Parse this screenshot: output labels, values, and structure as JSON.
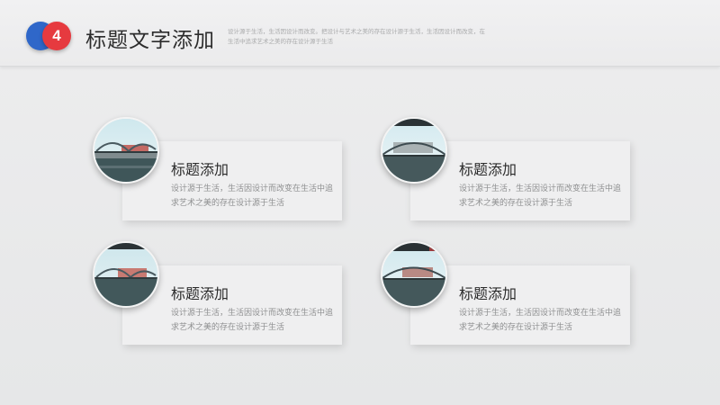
{
  "header": {
    "badge_number": "4",
    "title": "标题文字添加",
    "description": "设计源于生活，生活因设计而改变。把设计与艺术之美的存在设计源于生活，生活因设计而改变，在生活中追求艺术之美的存在设计源于生活"
  },
  "cards": [
    {
      "title": "标题添加",
      "body": "设计源于生活，生活因设计而改变在生活中追求艺术之美的存在设计源于生活",
      "image": "bridge-photo"
    },
    {
      "title": "标题添加",
      "body": "设计源于生活，生活因设计而改变在生活中追求艺术之美的存在设计源于生活",
      "image": "bridge-photo"
    },
    {
      "title": "标题添加",
      "body": "设计源于生活，生活因设计而改变在生活中追求艺术之美的存在设计源于生活",
      "image": "bridge-photo"
    },
    {
      "title": "标题添加",
      "body": "设计源于生活，生活因设计而改变在生活中追求艺术之美的存在设计源于生活",
      "image": "bridge-photo"
    }
  ],
  "colors": {
    "badge_blue": "#2f67c9",
    "badge_red": "#e63a3f",
    "background": "#e9eaeb"
  }
}
